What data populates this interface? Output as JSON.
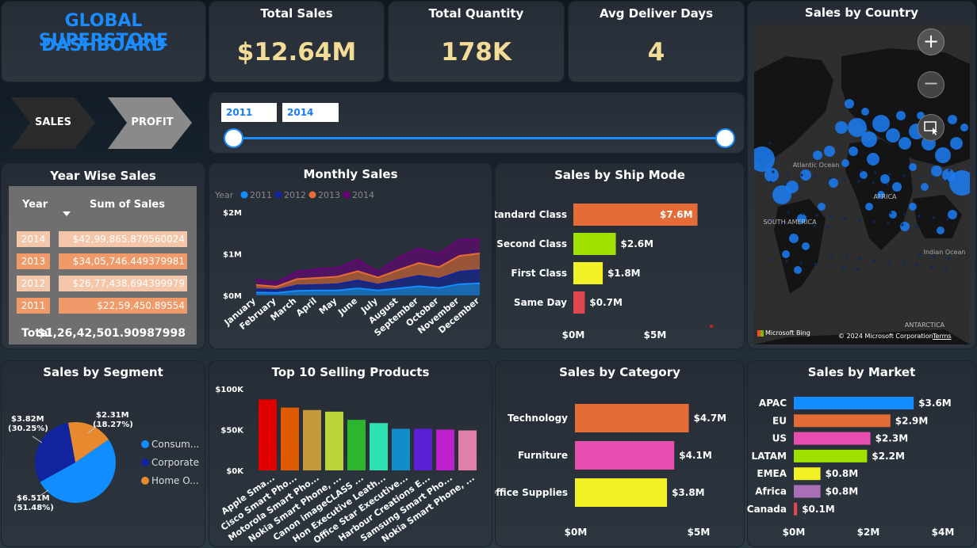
{
  "header": {
    "title_line1": "GLOBAL SUPERSTORE",
    "title_line2": "DASHBOARD"
  },
  "kpis": [
    {
      "label": "Total Sales",
      "value": "$12.64M"
    },
    {
      "label": "Total Quantity",
      "value": "178K"
    },
    {
      "label": "Avg Deliver Days",
      "value": "4"
    }
  ],
  "nav": {
    "sales": "SALES",
    "profit": "PROFIT"
  },
  "slicer": {
    "start": "2011",
    "end": "2014",
    "range": [
      2011,
      2014
    ]
  },
  "year_table": {
    "title": "Year Wise Sales",
    "col_year": "Year",
    "col_sales": "Sum of Sales",
    "rows": [
      {
        "year": "2014",
        "sales": "$42,99,865.870560024"
      },
      {
        "year": "2013",
        "sales": "$34,05,746.449379981"
      },
      {
        "year": "2012",
        "sales": "$26,77,438.694399979"
      },
      {
        "year": "2011",
        "sales": "$22,59,450.89554"
      }
    ],
    "total_label": "Total",
    "total_value": "$1,26,42,501.90987998"
  },
  "map": {
    "title": "Sales by Country",
    "labels": {
      "ocean": "Atlantic Ocean",
      "indian": "Indian Ocean",
      "sa": "SOUTH AMERICA",
      "africa": "AFRICA",
      "antarctica": "ANTARCTICA"
    },
    "bing": "Microsoft Bing",
    "copyright": "© 2024 Microsoft Corporation",
    "terms": "Terms",
    "colors": {
      "bubble": "#1a7cf5",
      "land": "#1a1a1a"
    }
  },
  "chart_data": [
    {
      "id": "monthly",
      "type": "area",
      "title": "Monthly Sales",
      "legend_title": "Year",
      "categories": [
        "January",
        "February",
        "March",
        "April",
        "May",
        "June",
        "July",
        "August",
        "September",
        "October",
        "November",
        "December"
      ],
      "series": [
        {
          "name": "2011",
          "color": "#118dff",
          "values": [
            0.07,
            0.06,
            0.11,
            0.12,
            0.12,
            0.17,
            0.12,
            0.17,
            0.22,
            0.18,
            0.27,
            0.29
          ]
        },
        {
          "name": "2012",
          "color": "#12239e",
          "values": [
            0.08,
            0.07,
            0.13,
            0.13,
            0.15,
            0.19,
            0.14,
            0.2,
            0.25,
            0.22,
            0.3,
            0.32
          ]
        },
        {
          "name": "2013",
          "color": "#e66c37",
          "values": [
            0.1,
            0.08,
            0.15,
            0.17,
            0.18,
            0.22,
            0.17,
            0.24,
            0.31,
            0.28,
            0.38,
            0.4
          ]
        },
        {
          "name": "2014",
          "color": "#6b007b",
          "values": [
            0.13,
            0.1,
            0.18,
            0.21,
            0.21,
            0.28,
            0.14,
            0.3,
            0.35,
            0.32,
            0.39,
            0.34
          ]
        }
      ],
      "y_ticks": [
        "$0M",
        "$1M",
        "$2M"
      ],
      "ylim": [
        0,
        2
      ]
    },
    {
      "id": "shipmode",
      "type": "bar",
      "title": "Sales by Ship Mode",
      "categories": [
        "Standard Class",
        "Second Class",
        "First Class",
        "Same Day"
      ],
      "values": [
        7.6,
        2.6,
        1.8,
        0.7
      ],
      "labels": [
        "$7.6M",
        "$2.6M",
        "$1.8M",
        "$0.7M"
      ],
      "colors": [
        "#e66c37",
        "#9fe000",
        "#f1f126",
        "#e0464e"
      ],
      "x_ticks": [
        "$0M",
        "$5M"
      ],
      "xlim": [
        0,
        10
      ]
    },
    {
      "id": "segment",
      "type": "pie",
      "title": "Sales by Segment",
      "slices": [
        {
          "name": "Consum...",
          "value": 6.51,
          "label": "$6.51M",
          "pct": "(51.48%)",
          "color": "#118dff"
        },
        {
          "name": "Corporate",
          "value": 3.82,
          "label": "$3.82M",
          "pct": "(30.25%)",
          "color": "#12239e"
        },
        {
          "name": "Home O...",
          "value": 2.31,
          "label": "$2.31M",
          "pct": "(18.27%)",
          "color": "#e6892f"
        }
      ]
    },
    {
      "id": "top10",
      "type": "bar",
      "title": "Top 10 Selling Products",
      "categories": [
        "Apple Sma...",
        "Cisco Smart Pho...",
        "Motorola Smart Pho...",
        "Nokia Smart Phone, ...",
        "Canon imageCLASS ...",
        "Hon Executive Leath...",
        "Office Star Executive...",
        "Harbour Creations E...",
        "Samsung Smart Pho...",
        "Nokia Smart Phone, ..."
      ],
      "values": [
        87,
        77,
        74,
        72,
        62,
        58,
        51,
        51,
        50,
        49
      ],
      "colors": [
        "#e00000",
        "#e05b00",
        "#c49a3c",
        "#b9d53a",
        "#2db52d",
        "#2fe0b0",
        "#118dca",
        "#5b1fd6",
        "#c01fd0",
        "#e07fa8"
      ],
      "y_ticks": [
        "$0K",
        "$50K",
        "$100K"
      ],
      "ylim": [
        0,
        100
      ]
    },
    {
      "id": "category",
      "type": "bar",
      "title": "Sales by Category",
      "categories": [
        "Technology",
        "Furniture",
        "Office Supplies"
      ],
      "values": [
        4.7,
        4.1,
        3.8
      ],
      "labels": [
        "$4.7M",
        "$4.1M",
        "$3.8M"
      ],
      "colors": [
        "#e66c37",
        "#e64fb0",
        "#f1f126"
      ],
      "x_ticks": [
        "$0M",
        "$5M"
      ],
      "xlim": [
        0,
        5.5
      ]
    },
    {
      "id": "market",
      "type": "bar",
      "title": "Sales by Market",
      "categories": [
        "APAC",
        "EU",
        "US",
        "LATAM",
        "EMEA",
        "Africa",
        "Canada"
      ],
      "values": [
        3.6,
        2.9,
        2.3,
        2.2,
        0.8,
        0.8,
        0.1
      ],
      "labels": [
        "$3.6M",
        "$2.9M",
        "$2.3M",
        "$2.2M",
        "$0.8M",
        "$0.8M",
        "$0.1M"
      ],
      "colors": [
        "#118dff",
        "#e66c37",
        "#e64fb0",
        "#9fe000",
        "#f1f126",
        "#a86fb8",
        "#e0464e"
      ],
      "x_ticks": [
        "$0M",
        "$2M",
        "$4M"
      ],
      "xlim": [
        0,
        4
      ]
    }
  ]
}
